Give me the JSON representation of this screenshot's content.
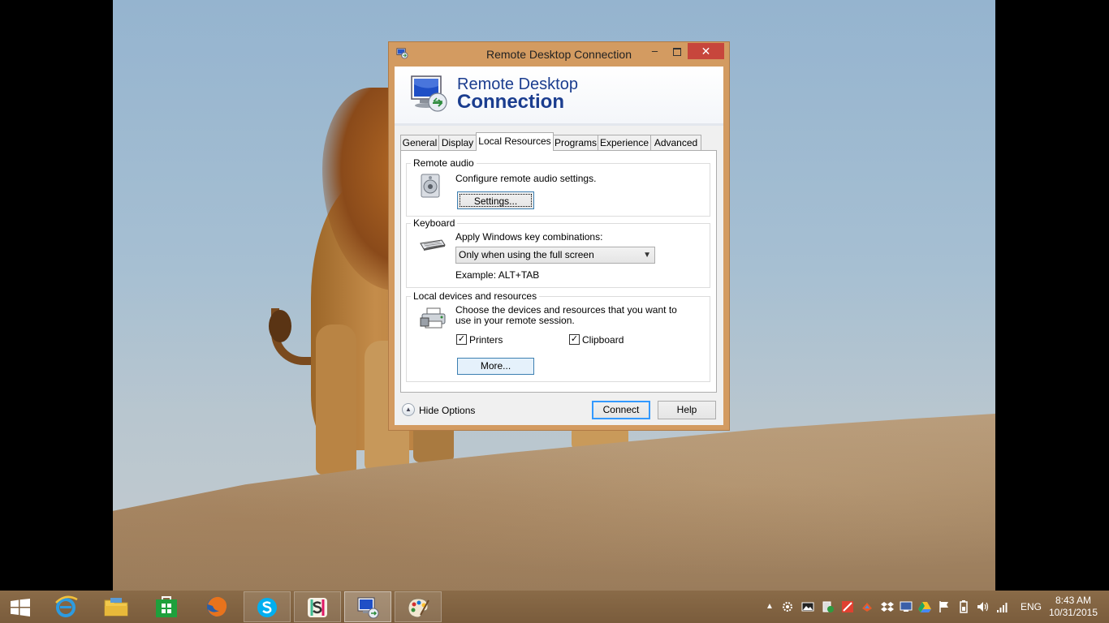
{
  "window": {
    "title": "Remote Desktop Connection",
    "minimize_glyph": "–",
    "close_glyph": "✕"
  },
  "banner": {
    "line1": "Remote Desktop",
    "line2": "Connection"
  },
  "tabs": [
    {
      "label": "General",
      "active": false
    },
    {
      "label": "Display",
      "active": false
    },
    {
      "label": "Local Resources",
      "active": true
    },
    {
      "label": "Programs",
      "active": false
    },
    {
      "label": "Experience",
      "active": false
    },
    {
      "label": "Advanced",
      "active": false
    }
  ],
  "remote_audio": {
    "group_label": "Remote audio",
    "description": "Configure remote audio settings.",
    "settings_button": "Settings..."
  },
  "keyboard": {
    "group_label": "Keyboard",
    "description": "Apply Windows key combinations:",
    "selected_option": "Only when using the full screen",
    "example": "Example: ALT+TAB"
  },
  "local_devices": {
    "group_label": "Local devices and resources",
    "description": "Choose the devices and resources that you want to use in your remote session.",
    "printers_label": "Printers",
    "printers_checked": true,
    "clipboard_label": "Clipboard",
    "clipboard_checked": true,
    "more_button": "More..."
  },
  "footer": {
    "hide_options": "Hide Options",
    "connect_button": "Connect",
    "help_button": "Help"
  },
  "taskbar": {
    "apps": [
      {
        "name": "start-button",
        "running": false
      },
      {
        "name": "internet-explorer",
        "running": false
      },
      {
        "name": "file-explorer",
        "running": false
      },
      {
        "name": "store",
        "running": false
      },
      {
        "name": "firefox",
        "running": false
      },
      {
        "name": "skype",
        "running": true
      },
      {
        "name": "slack",
        "running": true
      },
      {
        "name": "remote-desktop",
        "running": true,
        "active": true
      },
      {
        "name": "paint",
        "running": true
      }
    ],
    "language": "ENG",
    "time": "8:43 AM",
    "date": "10/31/2015"
  },
  "colors": {
    "banner_text": "#1b3d8f",
    "title_frame": "#d39b61",
    "close_button": "#c7463c",
    "taskbar": "#7a5c3c"
  }
}
